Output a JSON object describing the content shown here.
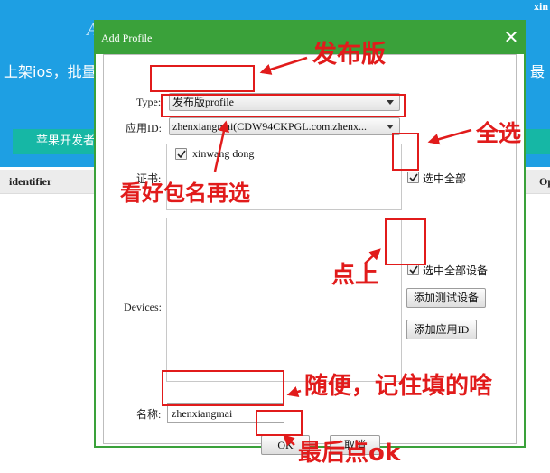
{
  "background": {
    "user_name": "xin",
    "banner_letter": "A",
    "banner_text_left": "上架ios，批量",
    "banner_text_right": "最",
    "teal_button": "苹果开发者",
    "col_identifier": "identifier",
    "col_right": "Op",
    "banner_color": "#1e9fe3",
    "teal_color": "#16b7a5"
  },
  "dialog": {
    "title": "Add Profile",
    "close_glyph": "✕",
    "accent_color": "#3aa13a",
    "type_label": "Type:",
    "type_value": "发布版profile",
    "app_id_label": "应用ID:",
    "app_id_value": "zhenxiangmai(CDW94CKPGL.com.zhenx...",
    "cert_label": "证书:",
    "cert_items": [
      {
        "name": "xinwang dong",
        "checked": true
      }
    ],
    "select_all_certs": "选中全部",
    "devices_label": "Devices:",
    "select_all_devices": "选中全部设备",
    "add_test_device": "添加测试设备",
    "add_app_id": "添加应用ID",
    "name_label": "名称:",
    "name_value": "zhenxiangmai",
    "ok_label": "OK",
    "cancel_label": "取消"
  },
  "annotations": {
    "color": "#e11b1b",
    "release_version": "发布版",
    "select_all": "全选",
    "check_package": "看好包名再选",
    "click_on": "点上",
    "remember_name": "随便，记住填的啥",
    "finally_ok": "最后点ok"
  }
}
